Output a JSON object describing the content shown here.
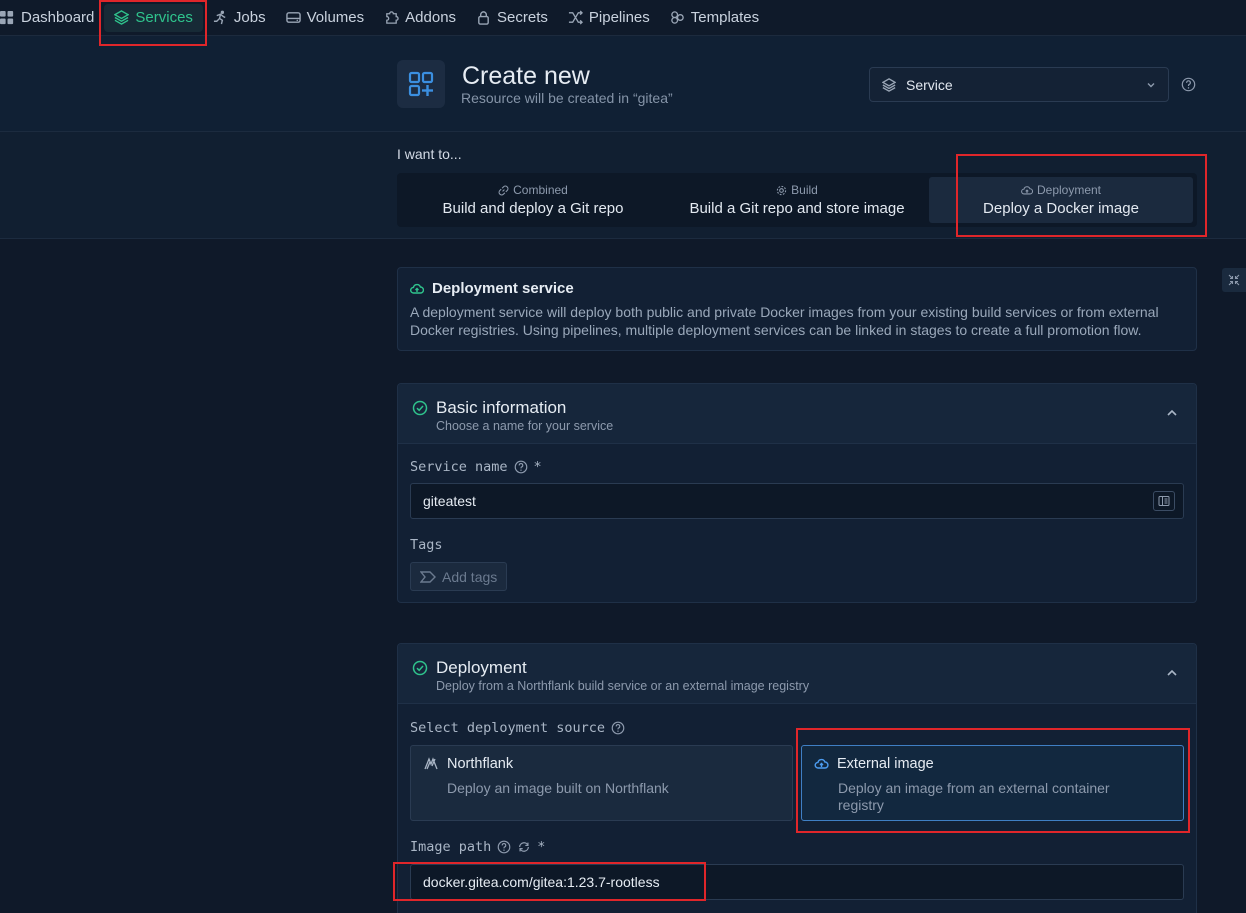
{
  "nav": {
    "items": [
      {
        "label": "Dashboard",
        "icon": "dashboard-icon"
      },
      {
        "label": "Services",
        "icon": "layers-icon",
        "active": true
      },
      {
        "label": "Jobs",
        "icon": "runner-icon"
      },
      {
        "label": "Volumes",
        "icon": "drive-icon"
      },
      {
        "label": "Addons",
        "icon": "puzzle-icon"
      },
      {
        "label": "Secrets",
        "icon": "lock-icon"
      },
      {
        "label": "Pipelines",
        "icon": "shuffle-icon"
      },
      {
        "label": "Templates",
        "icon": "templates-icon"
      }
    ]
  },
  "header": {
    "title": "Create new",
    "subtitle": "Resource will be created in “gitea”",
    "resource_type": "Service"
  },
  "want": {
    "label": "I want to...",
    "tabs": [
      {
        "kicker": "Combined",
        "label": "Build and deploy a Git repo"
      },
      {
        "kicker": "Build",
        "label": "Build a Git repo and store image"
      },
      {
        "kicker": "Deployment",
        "label": "Deploy a Docker image",
        "active": true
      }
    ]
  },
  "info": {
    "title": "Deployment service",
    "text": "A deployment service will deploy both public and private Docker images from your existing build services or from external Docker registries. Using pipelines, multiple deployment services can be linked in stages to create a full promotion flow."
  },
  "basic": {
    "title": "Basic information",
    "subtitle": "Choose a name for your service",
    "service_name_label": "Service name",
    "service_name_value": "giteatest",
    "tags_label": "Tags",
    "add_tags": "Add tags"
  },
  "deployment": {
    "title": "Deployment",
    "subtitle": "Deploy from a Northflank build service or an external image registry",
    "source_label": "Select deployment source",
    "options": [
      {
        "title": "Northflank",
        "desc": "Deploy an image built on Northflank"
      },
      {
        "title": "External image",
        "desc": "Deploy an image from an external container registry",
        "selected": true
      }
    ],
    "image_path_label": "Image path",
    "image_path_value": "docker.gitea.com/gitea:1.23.7-rootless"
  },
  "colors": {
    "accent_green": "#2fc48d",
    "accent_blue": "#3f7fc4",
    "highlight_red": "#e0262a"
  }
}
